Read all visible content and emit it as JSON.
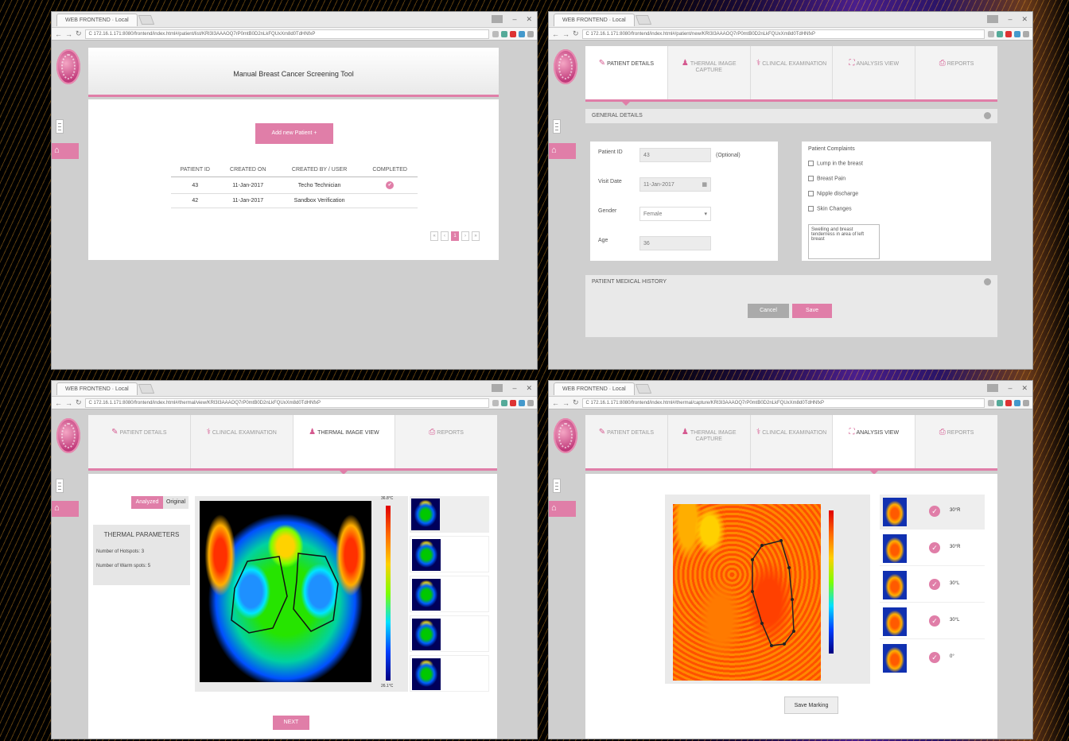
{
  "browser": {
    "tab_title_1": "WEB FRONTEND · Local",
    "tab_title_2": "WEB FRONTEND · Local",
    "url_1": "C 172.16.1.171:8080/frontend/index.html#/patient/list/KRl3I3AAAOQ7rP0mtB0D2nLkFQUxXm8d0TdHNfxP",
    "url_2": "C 172.16.1.171:8080/frontend/index.html#/patient/new/KRl3I3AAAOQ7rP0mtB0D2nLkFQUxXm8d0TdHNfxP",
    "url_3": "C 172.16.1.171:8080/frontend/index.html#/thermal/view/KRl3I3AAAOQ7rP0mtB0D2nLkFQUxXm8d0TdHNfxP",
    "url_4": "C 172.16.1.171:8080/frontend/index.html#/thermal/capture/KRl3I3AAAOQ7rP0mtB0D2nLkFQUxXm8d0TdHNfxP"
  },
  "screen1": {
    "title": "Manual Breast Cancer Screening Tool",
    "add_button": "Add new Patient +",
    "columns": [
      "PATIENT ID",
      "CREATED ON",
      "CREATED BY / USER",
      "COMPLETED"
    ],
    "rows": [
      {
        "id": "43",
        "date": "11-Jan-2017",
        "user": "Techo Technician",
        "done": "✔"
      },
      {
        "id": "42",
        "date": "11-Jan-2017",
        "user": "Sandbox Verification",
        "done": ""
      }
    ],
    "pagination": [
      "«",
      "‹",
      "1",
      "›",
      "»"
    ]
  },
  "screen2": {
    "tabs": [
      "PATIENT DETAILS",
      "THERMAL IMAGE CAPTURE",
      "CLINICAL EXAMINATION",
      "ANALYSIS VIEW",
      "REPORTS"
    ],
    "general_details": "GENERAL DETAILS",
    "patient_id_label": "Patient ID",
    "patient_id_value": "43",
    "patient_id_suffix": "(Optional)",
    "date_label": "Visit Date",
    "date_value": "11-Jan-2017",
    "gender_label": "Gender",
    "gender_value": "Female",
    "age_label": "Age",
    "age_value": "36",
    "complaints_label": "Patient Complaints",
    "complaints": [
      "Lump in the breast",
      "Breast Pain",
      "Nipple discharge",
      "Skin Changes"
    ],
    "notes": "Swelling and breast tenderness in area of left breast",
    "history_title": "PATIENT MEDICAL HISTORY",
    "cancel": "Cancel",
    "save": "Save"
  },
  "screen3": {
    "tabs": [
      "PATIENT DETAILS",
      "CLINICAL EXAMINATION",
      "THERMAL IMAGE VIEW",
      "REPORTS"
    ],
    "toggle_analyzed": "Analyzed",
    "toggle_original": "Original",
    "params_title": "THERMAL PARAMETERS",
    "param1": "Number of Hotspots: 3",
    "param2": "Number of Warm spots: 5",
    "scale_top": "36.8°C",
    "scale_bottom": "26.1°C",
    "next": "NEXT"
  },
  "screen4": {
    "tabs": [
      "PATIENT DETAILS",
      "THERMAL IMAGE CAPTURE",
      "CLINICAL EXAMINATION",
      "ANALYSIS VIEW",
      "REPORTS"
    ],
    "thumb_labels": [
      "30°R",
      "30°R",
      "30°L",
      "30°L",
      "0°"
    ],
    "save_button": "Save Marking"
  },
  "colors": {
    "accent": "#e07ea8",
    "panel": "#cfcfcf"
  }
}
